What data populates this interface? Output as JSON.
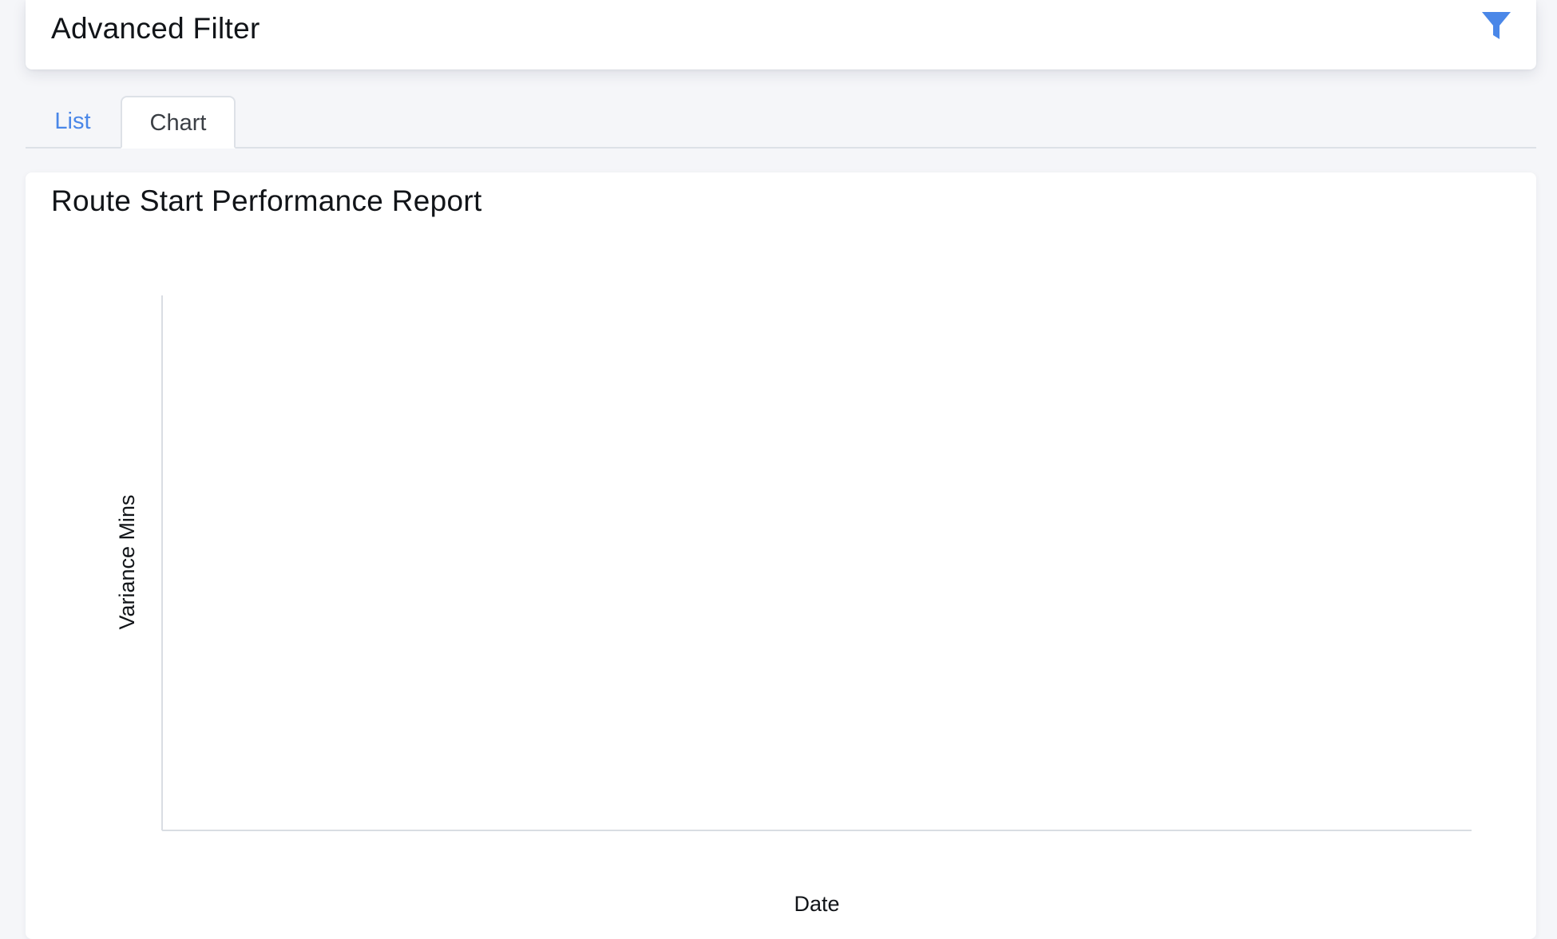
{
  "filter": {
    "title": "Advanced Filter",
    "icon": "filter-icon",
    "accent": "#4a87e8"
  },
  "tabs": [
    {
      "label": "List",
      "active": false
    },
    {
      "label": "Chart",
      "active": true
    }
  ],
  "report": {
    "title": "Route Start Performance Report"
  },
  "chart_data": {
    "type": "line",
    "title": "",
    "xlabel": "Date",
    "ylabel": "Variance Mins",
    "series": [],
    "grid": false
  }
}
